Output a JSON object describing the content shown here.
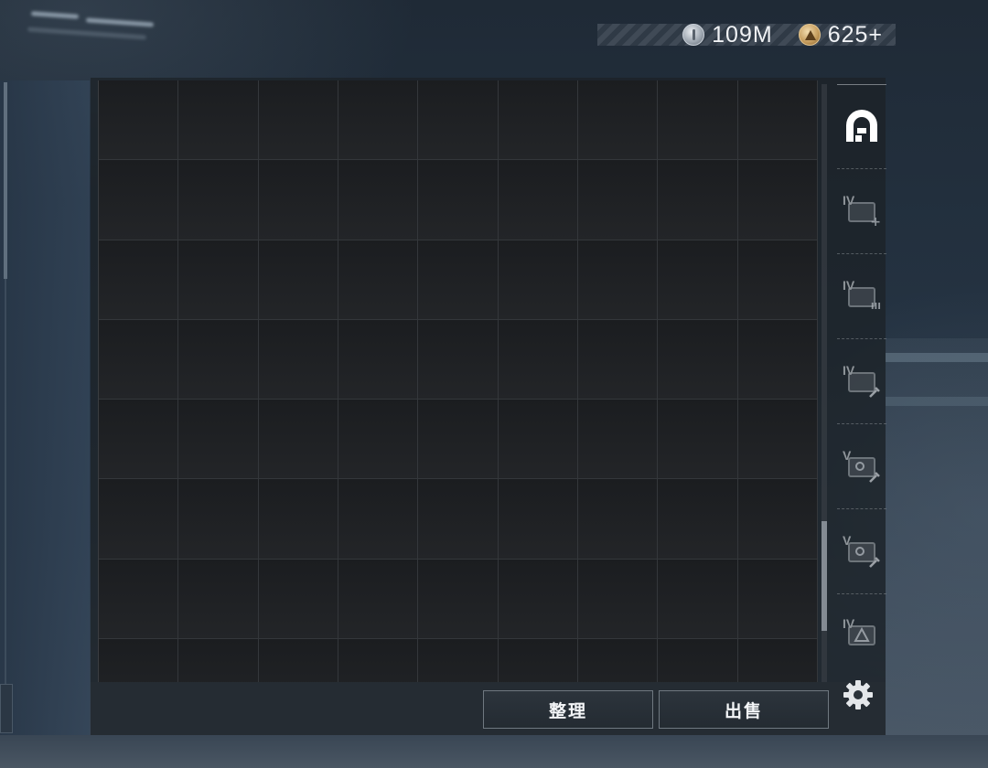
{
  "currency": {
    "silver": {
      "icon": "silver-coin-icon",
      "value": "109M"
    },
    "gold": {
      "icon": "gold-coin-icon",
      "value": "625+"
    }
  },
  "grid": {
    "columns": 9,
    "rows": 8
  },
  "sidebar": {
    "tabs": [
      {
        "id": "home",
        "icon": "safe-box-icon",
        "tier": "",
        "badge": "",
        "active": true
      },
      {
        "id": "case-add",
        "icon": "case-add-icon",
        "tier": "IV",
        "badge": "+"
      },
      {
        "id": "case-folder",
        "icon": "case-folder-icon",
        "tier": "IV",
        "badge": "III"
      },
      {
        "id": "case-tool",
        "icon": "case-tool-icon",
        "tier": "IV",
        "badge": ""
      },
      {
        "id": "case-camera-1",
        "icon": "case-camera-icon",
        "tier": "V",
        "badge": ""
      },
      {
        "id": "case-camera-2",
        "icon": "case-camera-icon",
        "tier": "V",
        "badge": ""
      },
      {
        "id": "case-triangle",
        "icon": "case-triangle-icon",
        "tier": "IV",
        "badge": ""
      }
    ]
  },
  "actions": {
    "sort_label": "整理",
    "sell_label": "出售"
  },
  "colors": {
    "button_border": "#6f7880",
    "grid_line": "#34373b",
    "active_icon": "#ffffff"
  }
}
